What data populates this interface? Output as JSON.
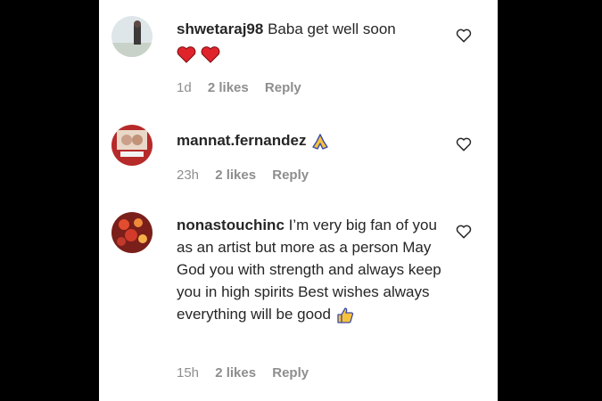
{
  "comments": [
    {
      "username": "shwetaraj98",
      "text": "Baba get well soon",
      "time": "1d",
      "likes": "2 likes",
      "reply": "Reply",
      "emojis": [
        "heart-emoji",
        "heart-emoji"
      ]
    },
    {
      "username": "mannat.fernandez",
      "text": "",
      "time": "23h",
      "likes": "2 likes",
      "reply": "Reply",
      "emojis": [
        "folded-hands-emoji"
      ]
    },
    {
      "username": "nonastouchinc",
      "text": "I’m very big fan of you as an artist but more as a person May God you with strength and always keep you in high spirits Best wishes always everything will be good",
      "time": "15h",
      "likes": "2 likes",
      "reply": "Reply",
      "emojis": [
        "thumbs-up-emoji"
      ]
    }
  ],
  "colors": {
    "text": "#262626",
    "meta": "#8e8e8e",
    "heart_emoji": "#e0242c",
    "thumbs": "#f7c23b"
  },
  "icons": {
    "like": "heart-outline-icon"
  }
}
